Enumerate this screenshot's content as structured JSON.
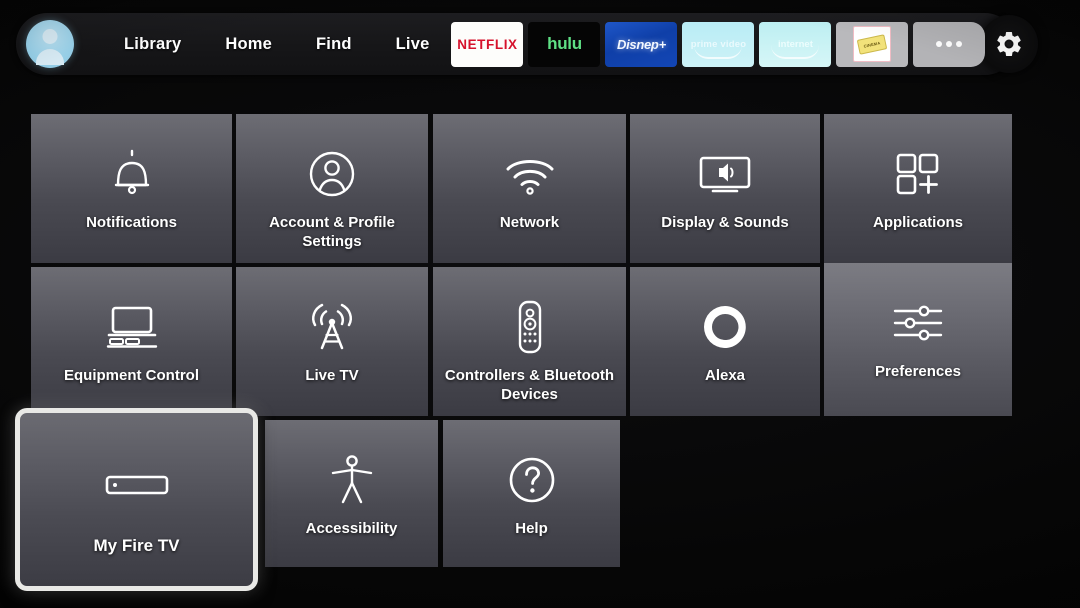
{
  "nav": {
    "avatar": "profile-avatar",
    "links": [
      {
        "label": "Library"
      },
      {
        "label": "Home"
      },
      {
        "label": "Find"
      },
      {
        "label": "Live"
      }
    ],
    "apps": [
      {
        "name": "netflix",
        "label": "NETFLIX"
      },
      {
        "name": "hulu",
        "label": "hulu"
      },
      {
        "name": "disney-plus",
        "label": "Disnep+"
      },
      {
        "name": "prime-video",
        "label": "prime video"
      },
      {
        "name": "internet",
        "label": "internet"
      },
      {
        "name": "cinema-ticket",
        "label": "CINEMA"
      },
      {
        "name": "more-apps",
        "label": "•••"
      }
    ],
    "settings_button": "gear-icon"
  },
  "settings": {
    "tiles": [
      {
        "id": "notifications",
        "label": "Notifications",
        "icon": "bell-icon",
        "selected": false
      },
      {
        "id": "account",
        "label": "Account & Profile Settings",
        "icon": "person-circle-icon",
        "selected": false
      },
      {
        "id": "network",
        "label": "Network",
        "icon": "wifi-icon",
        "selected": false
      },
      {
        "id": "display",
        "label": "Display & Sounds",
        "icon": "tv-speaker-icon",
        "selected": false
      },
      {
        "id": "applications",
        "label": "Applications",
        "icon": "app-grid-plus-icon",
        "selected": false
      },
      {
        "id": "equipment",
        "label": "Equipment Control",
        "icon": "monitor-devices-icon",
        "selected": false
      },
      {
        "id": "livetv",
        "label": "Live TV",
        "icon": "broadcast-tower-icon",
        "selected": false
      },
      {
        "id": "controllers",
        "label": "Controllers & Bluetooth Devices",
        "icon": "remote-icon",
        "selected": false
      },
      {
        "id": "alexa",
        "label": "Alexa",
        "icon": "alexa-ring-icon",
        "selected": false
      },
      {
        "id": "preferences",
        "label": "Preferences",
        "icon": "sliders-icon",
        "selected": false
      },
      {
        "id": "myfiretv",
        "label": "My Fire TV",
        "icon": "firetv-stick-icon",
        "selected": true
      },
      {
        "id": "accessibility",
        "label": "Accessibility",
        "icon": "accessibility-icon",
        "selected": false
      },
      {
        "id": "help",
        "label": "Help",
        "icon": "question-circle-icon",
        "selected": false
      }
    ]
  },
  "colors": {
    "background": "#000000",
    "tile_top": "#6d6d74",
    "tile_bottom": "#3b3b43",
    "selection_border": "#e9e9e6",
    "nav_bar": "#1d1d20",
    "avatar": "#9dd7f0",
    "netflix_red": "#d6122c",
    "hulu_green": "#5fe085"
  }
}
